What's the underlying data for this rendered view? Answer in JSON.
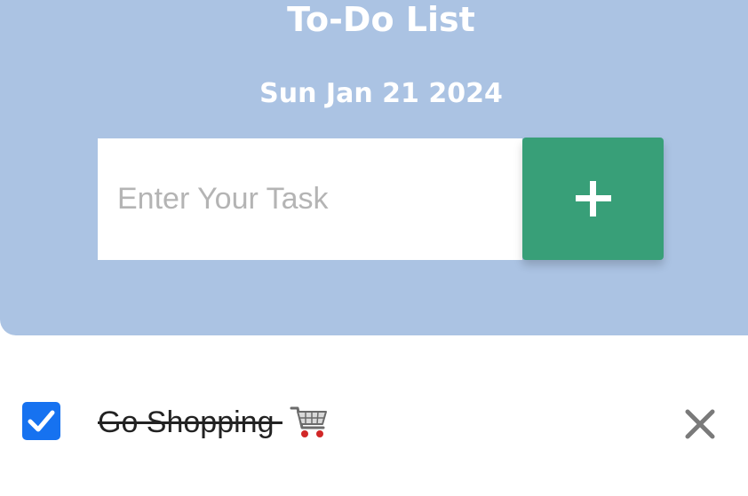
{
  "header": {
    "title": "To-Do List",
    "date": "Sun Jan 21 2024"
  },
  "task_input": {
    "placeholder": "Enter Your Task",
    "value": ""
  },
  "add_button": {
    "icon": "plus-icon"
  },
  "tasks": [
    {
      "text": "Go Shopping",
      "emoji_icon": "shopping-cart-icon",
      "completed": true,
      "delete_icon": "close-icon"
    }
  ],
  "colors": {
    "header_background": "#abc3e3",
    "add_button": "#389f78",
    "checkbox": "#1672f0",
    "delete_icon": "#7a7a7a"
  }
}
